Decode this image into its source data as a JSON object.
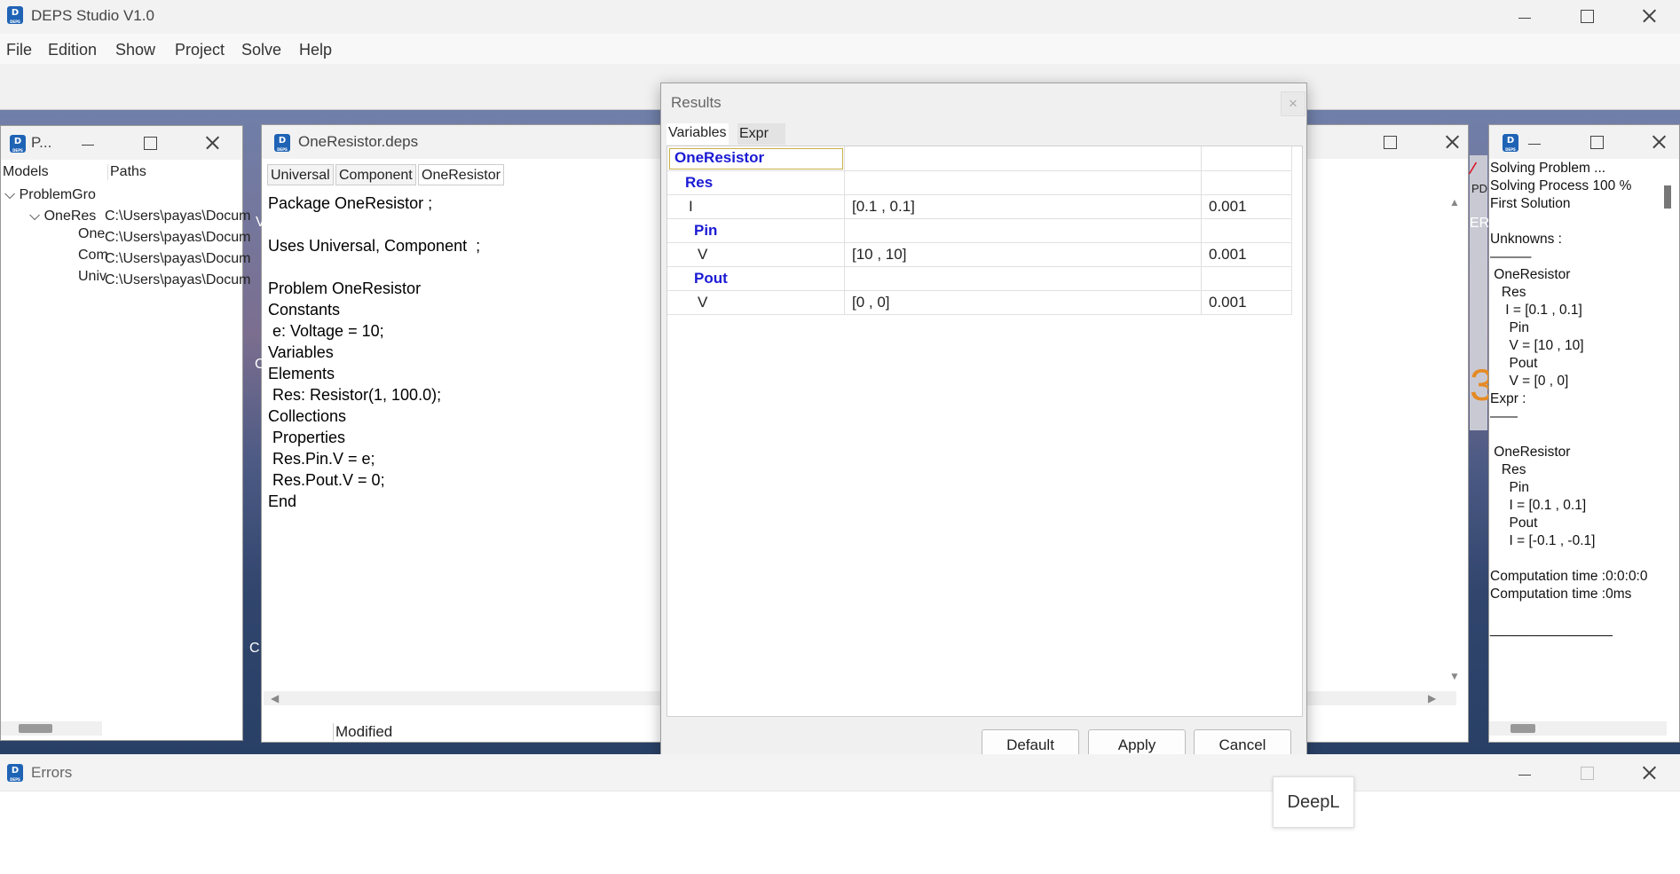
{
  "app": {
    "title": "DEPS Studio V1.0"
  },
  "menu": [
    "File",
    "Edition",
    "Show",
    "Project",
    "Solve",
    "Help"
  ],
  "models_panel": {
    "title": "P...",
    "col_models": "Models",
    "col_paths": "Paths",
    "tree": [
      {
        "label": "ProblemGro",
        "toggle": "⌵"
      },
      {
        "label": "OneRes",
        "toggle": "⌵"
      },
      {
        "label": "One"
      },
      {
        "label": "Com"
      },
      {
        "label": "Univ"
      }
    ],
    "paths": [
      "C:\\Users\\payas\\Docum",
      "C:\\Users\\payas\\Docum",
      "C:\\Users\\payas\\Docum",
      "C:\\Users\\payas\\Docum"
    ]
  },
  "editor": {
    "title": "OneResistor.deps",
    "tabs": [
      "Universal",
      "Component",
      "OneResistor"
    ],
    "code": [
      "Package OneResistor ;",
      "",
      "Uses Universal, Component  ;",
      "",
      "Problem OneResistor",
      "Constants",
      " e: Voltage = 10;",
      "Variables",
      "Elements",
      " Res: Resistor(1, 100.0);",
      "Collections",
      " Properties",
      " Res.Pin.V = e;",
      " Res.Pout.V = 0;",
      "End"
    ],
    "status": "Modified"
  },
  "results": {
    "title": "Results",
    "close_glyph": "×",
    "tabs": [
      "Variables",
      "Expr"
    ],
    "rows": [
      {
        "name": "OneResistor",
        "value": "",
        "precision": "",
        "kind": "group"
      },
      {
        "name": "Res",
        "value": "",
        "precision": "",
        "kind": "group"
      },
      {
        "name": "I",
        "value": "[0.1 , 0.1]",
        "precision": "0.001",
        "kind": "var"
      },
      {
        "name": "Pin",
        "value": "",
        "precision": "",
        "kind": "group"
      },
      {
        "name": "V",
        "value": "[10 , 10]",
        "precision": "0.001",
        "kind": "var"
      },
      {
        "name": "Pout",
        "value": "",
        "precision": "",
        "kind": "group"
      },
      {
        "name": "V",
        "value": "[0 , 0]",
        "precision": "0.001",
        "kind": "var"
      }
    ],
    "buttons": {
      "default": "Default",
      "apply": "Apply",
      "cancel": "Cancel"
    }
  },
  "peek": {
    "text1": "V",
    "text2": "C",
    "text3": "C",
    "pdf_label": "PD",
    "er_label": "ER",
    "digit": "3"
  },
  "log": {
    "lines": [
      "Solving Problem ...",
      "Solving Process 100 %",
      "First Solution",
      "",
      "Unknowns :",
      "———",
      " OneResistor",
      "   Res",
      "    I = [0.1 , 0.1]",
      "     Pin",
      "     V = [10 , 10]",
      "     Pout",
      "     V = [0 , 0]",
      "Expr :",
      "——",
      "",
      " OneResistor",
      "   Res",
      "     Pin",
      "     I = [0.1 , 0.1]",
      "     Pout",
      "     I = [-0.1 , -0.1]",
      "",
      "Computation time :0:0:0:0",
      "Computation time :0ms",
      "",
      "________________"
    ]
  },
  "errors": {
    "title": "Errors"
  },
  "deepl": {
    "label": "DeepL"
  }
}
